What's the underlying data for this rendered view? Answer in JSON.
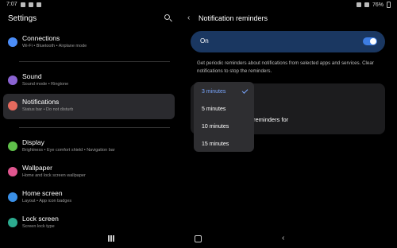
{
  "status_bar": {
    "time": "7:07",
    "battery": "76%"
  },
  "left_pane": {
    "title": "Settings",
    "items": [
      {
        "title": "Connections",
        "subtitle": "Wi-Fi • Bluetooth • Airplane mode",
        "icon": "wifi-icon",
        "color": "#4b8df8"
      },
      {
        "title": "Sound",
        "subtitle": "Sound mode • Ringtone",
        "icon": "speaker-icon",
        "color": "#8a63d2"
      },
      {
        "title": "Notifications",
        "subtitle": "Status bar • Do not disturb",
        "icon": "bell-icon",
        "color": "#e56a5e"
      },
      {
        "title": "Display",
        "subtitle": "Brightness • Eye comfort shield • Navigation bar",
        "icon": "sun-icon",
        "color": "#5fbf4a"
      },
      {
        "title": "Wallpaper",
        "subtitle": "Home and lock screen wallpaper",
        "icon": "image-icon",
        "color": "#e0568f"
      },
      {
        "title": "Home screen",
        "subtitle": "Layout • App icon badges",
        "icon": "home-icon",
        "color": "#3a8fe6"
      },
      {
        "title": "Lock screen",
        "subtitle": "Screen lock type",
        "icon": "lock-icon",
        "color": "#2cab8f"
      }
    ]
  },
  "right_pane": {
    "title": "Notification reminders",
    "toggle_label": "On",
    "description": "Get periodic reminders about notifications from selected apps and services. Clear notifications to stop the reminders.",
    "card2_text": "reminders for",
    "dropdown": {
      "options": [
        "3 minutes",
        "5 minutes",
        "10 minutes",
        "15 minutes"
      ],
      "selected": "3 minutes"
    }
  }
}
